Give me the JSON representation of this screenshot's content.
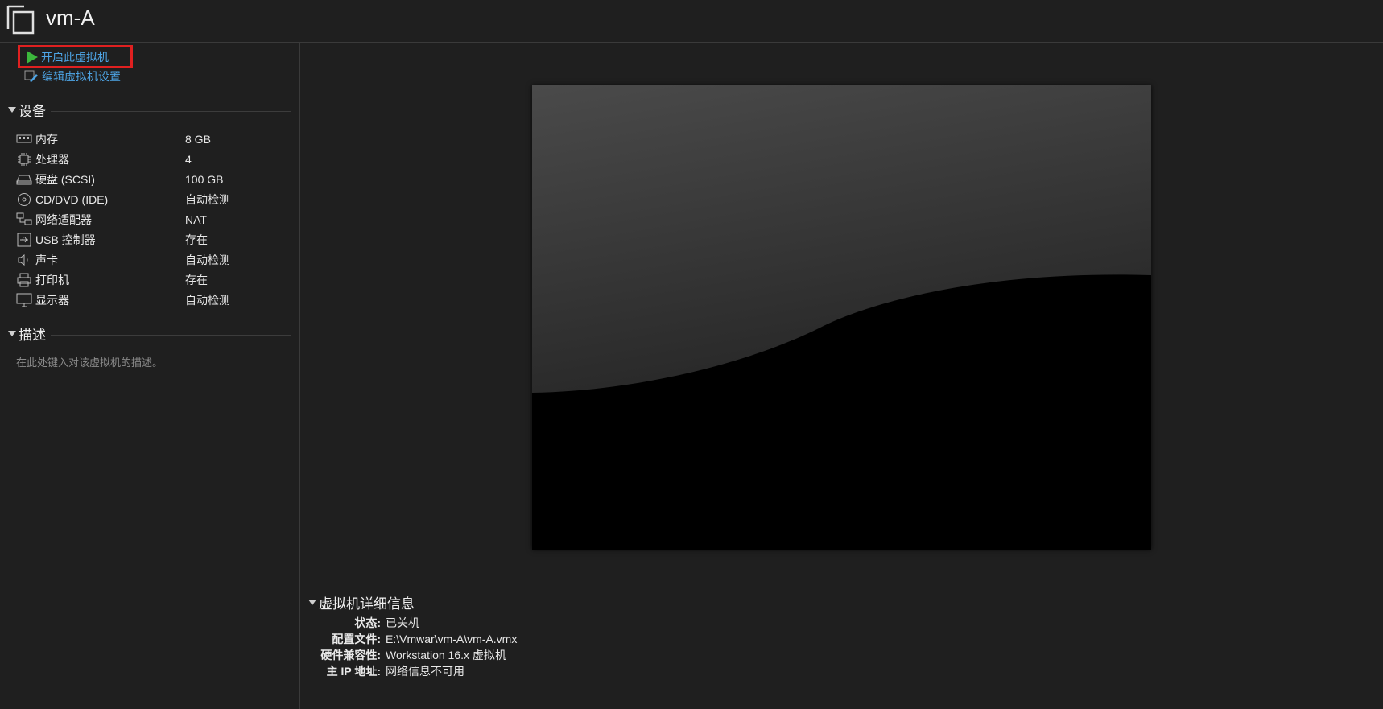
{
  "header": {
    "title": "vm-A",
    "icon": "vm-window-icon"
  },
  "actions": {
    "power_on": "开启此虚拟机",
    "edit_settings": "编辑虚拟机设置"
  },
  "devices": {
    "heading": "设备",
    "items": [
      {
        "icon": "memory-icon",
        "name": "内存",
        "value": "8 GB"
      },
      {
        "icon": "processor-icon",
        "name": "处理器",
        "value": "4"
      },
      {
        "icon": "disk-icon",
        "name": "硬盘 (SCSI)",
        "value": "100 GB"
      },
      {
        "icon": "cd-dvd-icon",
        "name": "CD/DVD (IDE)",
        "value": "自动检测"
      },
      {
        "icon": "network-icon",
        "name": "网络适配器",
        "value": "NAT"
      },
      {
        "icon": "usb-icon",
        "name": "USB 控制器",
        "value": "存在"
      },
      {
        "icon": "sound-icon",
        "name": "声卡",
        "value": "自动检测"
      },
      {
        "icon": "printer-icon",
        "name": "打印机",
        "value": "存在"
      },
      {
        "icon": "display-icon",
        "name": "显示器",
        "value": "自动检测"
      }
    ]
  },
  "description": {
    "heading": "描述",
    "placeholder": "在此处键入对该虚拟机的描述。"
  },
  "details": {
    "heading": "虚拟机详细信息",
    "rows": [
      {
        "key": "状态:",
        "value": "已关机"
      },
      {
        "key": "配置文件:",
        "value": "E:\\Vmwar\\vm-A\\vm-A.vmx"
      },
      {
        "key": "硬件兼容性:",
        "value": "Workstation 16.x 虚拟机"
      },
      {
        "key": "主 IP 地址:",
        "value": "网络信息不可用"
      }
    ]
  },
  "colors": {
    "accent_link": "#4ea5e6",
    "highlight_box": "#e02020",
    "play_green": "#3cb83c"
  }
}
